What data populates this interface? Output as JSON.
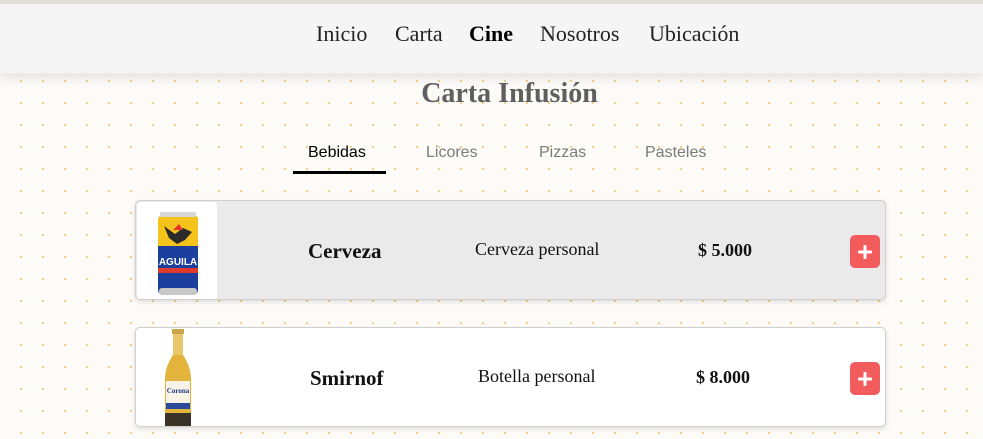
{
  "nav": {
    "links": [
      "Inicio",
      "Carta",
      "Cine",
      "Nosotros",
      "Ubicación"
    ],
    "active": "Cine"
  },
  "page": {
    "title": "Carta Infusión"
  },
  "tabs": {
    "items": [
      "Bebidas",
      "Licores",
      "Pizzas",
      "Pasteles"
    ],
    "active": "Bebidas"
  },
  "products": [
    {
      "name": "Cerveza",
      "description": "Cerveza personal",
      "price": "$ 5.000",
      "image": "aguila-can-icon",
      "brand_text": "AGUILA"
    },
    {
      "name": "Smirnof",
      "description": "Botella personal",
      "price": "$ 8.000",
      "image": "corona-bottle-icon",
      "brand_text": "Corona"
    }
  ],
  "colors": {
    "accent_button": "#f25c5c",
    "navbar": "#f5f5f5",
    "title": "#5f5f5f",
    "card_highlight": "#eaeaea"
  }
}
